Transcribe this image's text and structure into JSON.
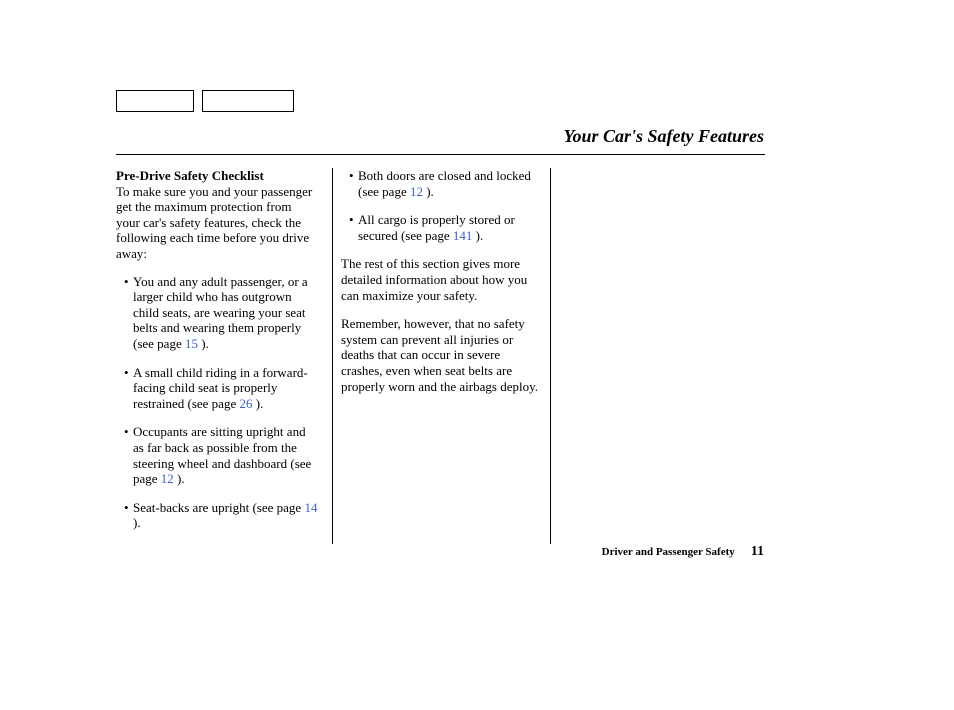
{
  "page_title": "Your Car's Safety Features",
  "checklist_heading": "Pre-Drive Safety Checklist",
  "intro_text": "To make sure you and your passenger get the maximum protection from your car's safety features, check the following each time before you drive away:",
  "bullets_left": [
    {
      "text_before": "You and any adult passenger, or a larger child who has outgrown child seats, are wearing your seat belts and wearing them properly (see page ",
      "page_ref": "15",
      "text_after": " )."
    },
    {
      "text_before": "A small child riding in a forward-facing child seat is properly restrained (see page ",
      "page_ref": "26",
      "text_after": " )."
    },
    {
      "text_before": "Occupants are sitting upright and as far back as possible from the steering wheel and dashboard (see page ",
      "page_ref": "12",
      "text_after": " )."
    },
    {
      "text_before": "Seat-backs are upright (see page ",
      "page_ref": "14",
      "text_after": " )."
    }
  ],
  "bullets_mid": [
    {
      "text_before": "Both doors are closed and locked (see page ",
      "page_ref": "12",
      "text_after": " )."
    },
    {
      "text_before": "All cargo is properly stored or secured (see page ",
      "page_ref": "141",
      "text_after": " )."
    }
  ],
  "mid_para_1": "The rest of this section gives more detailed information about how you can maximize your safety.",
  "mid_para_2": "Remember, however, that no safety system can prevent all injuries or deaths that can occur in severe crashes, even when seat belts are properly worn and the airbags deploy.",
  "footer_section": "Driver and Passenger Safety",
  "page_number": "11"
}
